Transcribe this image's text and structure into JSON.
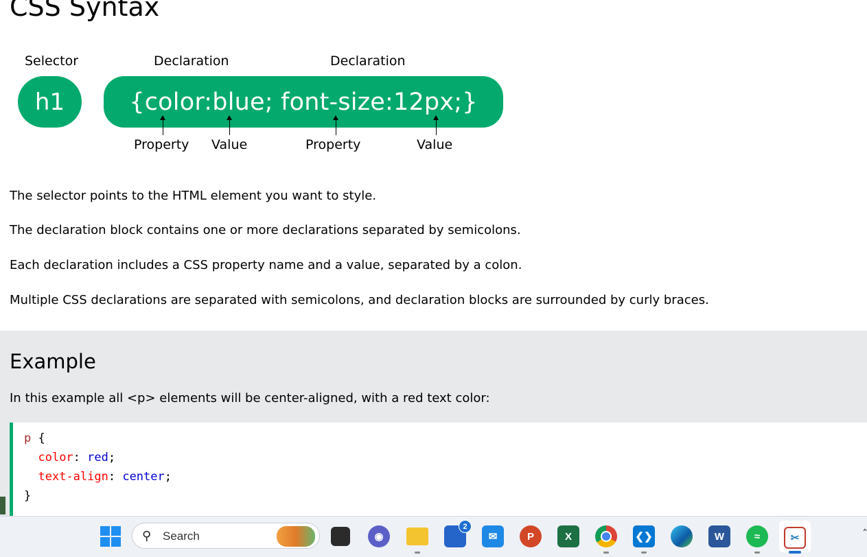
{
  "page": {
    "title": "CSS Syntax"
  },
  "syntax_diagram": {
    "top_labels": [
      "Selector",
      "Declaration",
      "Declaration"
    ],
    "selector": "h1",
    "declaration_block": "{color:blue; font-size:12px;}",
    "bottom_labels": [
      "Property",
      "Value",
      "Property",
      "Value"
    ],
    "pill_color": "#04AA6D"
  },
  "descriptions": [
    "The selector points to the HTML element you want to style.",
    "The declaration block contains one or more declarations separated by semicolons.",
    "Each declaration includes a CSS property name and a value, separated by a colon.",
    "Multiple CSS declarations are separated with semicolons, and declaration blocks are surrounded by curly braces."
  ],
  "example": {
    "heading": "Example",
    "text": "In this example all <p> elements will be center-aligned, with a red text color:",
    "code": {
      "selector": "p",
      "open_brace": " {",
      "declarations": [
        {
          "property": "color",
          "value": "red"
        },
        {
          "property": "text-align",
          "value": "center"
        }
      ],
      "close_brace": "}"
    },
    "panel_color": "#E7E9EB",
    "accent_color": "#04AA6D"
  },
  "taskbar": {
    "search_placeholder": "Search",
    "apps": [
      {
        "name": "task-view",
        "icon": "task-view-icon"
      },
      {
        "name": "meet",
        "icon": "video-chat-icon"
      },
      {
        "name": "file-explorer",
        "icon": "folder-icon"
      },
      {
        "name": "microsoft-store",
        "icon": "store-icon",
        "badge": "2"
      },
      {
        "name": "mail",
        "icon": "mail-icon"
      },
      {
        "name": "powerpoint",
        "icon": "powerpoint-icon",
        "letter": "P"
      },
      {
        "name": "excel",
        "icon": "excel-icon",
        "letter": "X"
      },
      {
        "name": "chrome",
        "icon": "chrome-icon"
      },
      {
        "name": "vscode",
        "icon": "vscode-icon"
      },
      {
        "name": "edge",
        "icon": "edge-icon"
      },
      {
        "name": "word",
        "icon": "word-icon",
        "letter": "W"
      },
      {
        "name": "spotify",
        "icon": "spotify-icon"
      },
      {
        "name": "snipping-tool",
        "icon": "snipping-tool-icon"
      }
    ]
  }
}
